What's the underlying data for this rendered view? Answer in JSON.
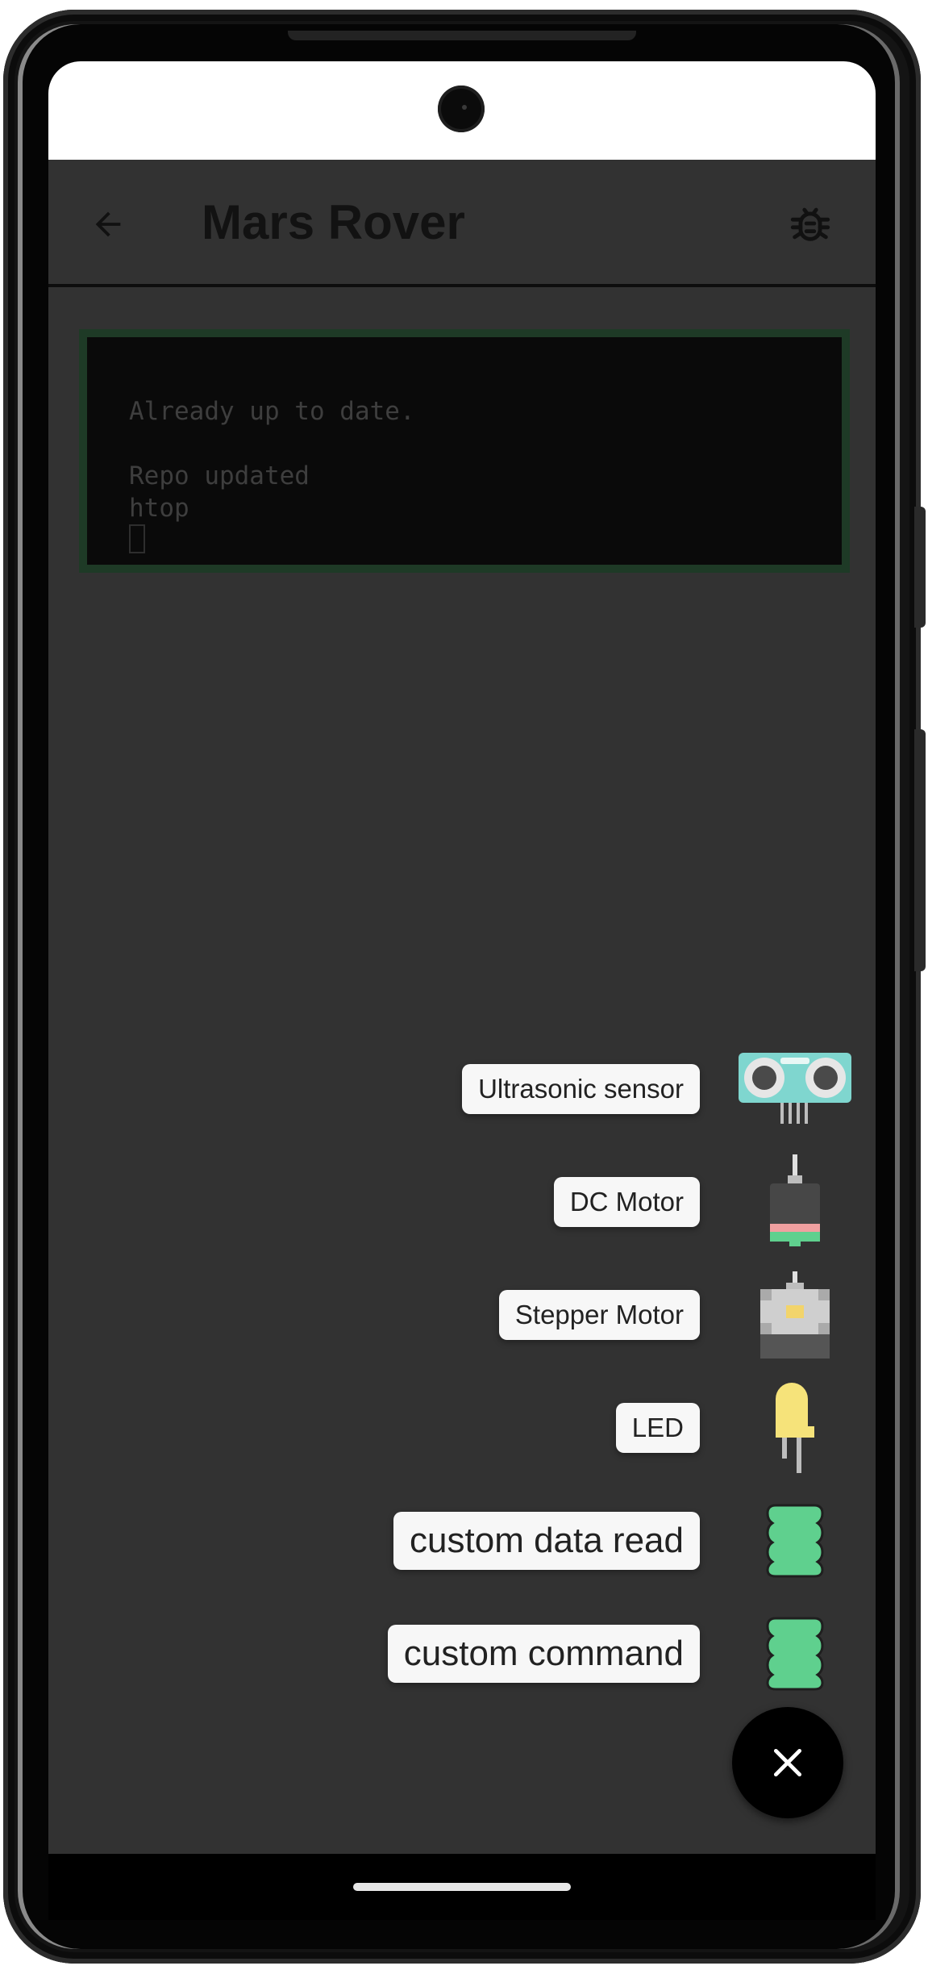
{
  "app_bar": {
    "title": "Mars Rover",
    "back_icon": "arrow-left-icon",
    "debug_icon": "bug-icon"
  },
  "terminal": {
    "lines": [
      "Already up to date.",
      "",
      "Repo updated",
      "htop"
    ],
    "border_color": "#1e3a26",
    "text_color": "#3e3e3e"
  },
  "speed_dial": {
    "items": [
      {
        "label": "Ultrasonic sensor",
        "icon": "ultrasonic-sensor-icon"
      },
      {
        "label": "DC Motor",
        "icon": "dc-motor-icon"
      },
      {
        "label": "Stepper Motor",
        "icon": "stepper-motor-icon"
      },
      {
        "label": "LED",
        "icon": "led-icon"
      },
      {
        "label": "custom data read",
        "icon": "custom-block-icon"
      },
      {
        "label": "custom command",
        "icon": "custom-block-icon"
      }
    ],
    "fab_icon": "close-icon"
  },
  "colors": {
    "background": "#323232",
    "fab": "#000000",
    "custom_block": "#5fd08e"
  }
}
